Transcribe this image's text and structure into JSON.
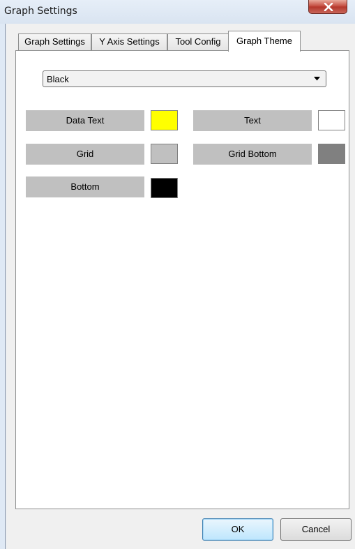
{
  "window": {
    "title": "Graph Settings"
  },
  "tabs": [
    {
      "label": "Graph Settings",
      "active": false
    },
    {
      "label": "Y Axis Settings",
      "active": false
    },
    {
      "label": "Tool Config",
      "active": false
    },
    {
      "label": "Graph Theme",
      "active": true
    }
  ],
  "theme_select": {
    "value": "Black"
  },
  "colors": {
    "data_text": {
      "label": "Data Text",
      "color": "#ffff00"
    },
    "text": {
      "label": "Text",
      "color": "#ffffff"
    },
    "grid": {
      "label": "Grid",
      "color": "#c0c0c0"
    },
    "grid_bottom": {
      "label": "Grid Bottom",
      "color": "#808080"
    },
    "bottom": {
      "label": "Bottom",
      "color": "#000000"
    }
  },
  "buttons": {
    "ok": "OK",
    "cancel": "Cancel"
  },
  "icons": {
    "close": "close-icon",
    "dropdown": "chevron-down-icon"
  }
}
